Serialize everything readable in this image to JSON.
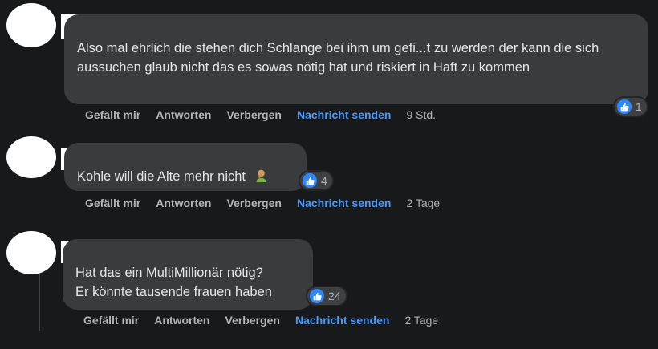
{
  "comments": [
    {
      "text": "Also mal ehrlich die stehen dich Schlange bei ihm um gefi...t zu werden der kann die sich aussuchen glaub nicht das es sowas nötig hat und riskiert in Haft zu kommen",
      "reaction_count": "1",
      "actions": {
        "like": "Gefällt mir",
        "reply": "Antworten",
        "hide": "Verbergen",
        "send": "Nachricht senden",
        "time": "9 Std."
      }
    },
    {
      "text": "Kohle will die Alte mehr nicht",
      "emoji": "🤦",
      "reaction_count": "4",
      "actions": {
        "like": "Gefällt mir",
        "reply": "Antworten",
        "hide": "Verbergen",
        "send": "Nachricht senden",
        "time": "2 Tage"
      }
    },
    {
      "text_line1": "Hat das ein MultiMillionär nötig?",
      "text_line2": "Er könnte tausende frauen haben",
      "reaction_count": "24",
      "actions": {
        "like": "Gefällt mir",
        "reply": "Antworten",
        "hide": "Verbergen",
        "send": "Nachricht senden",
        "time": "2 Tage"
      }
    }
  ],
  "colors": {
    "background": "#18191a",
    "bubble": "#3a3b3c",
    "link": "#4599ff",
    "like": "#2d88ff"
  }
}
